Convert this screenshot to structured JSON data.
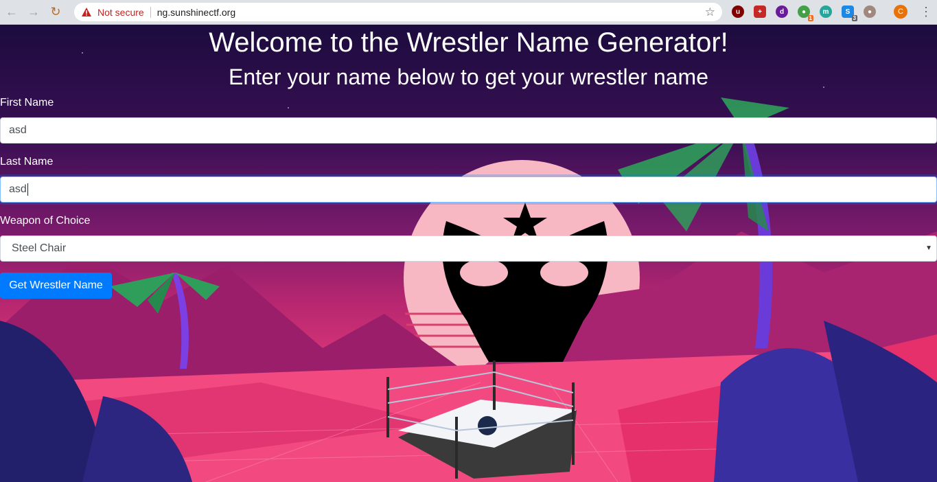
{
  "browser": {
    "security_label": "Not secure",
    "url": "ng.sunshinectf.org",
    "extension_badges": [
      "1",
      "3"
    ],
    "profile_initial": "C"
  },
  "page": {
    "title": "Welcome to the Wrestler Name Generator!",
    "subtitle": "Enter your name below to get your wrestler name",
    "first_name": {
      "label": "First Name",
      "value": "asd"
    },
    "last_name": {
      "label": "Last Name",
      "value": "asd"
    },
    "weapon": {
      "label": "Weapon of Choice",
      "selected": "Steel Chair"
    },
    "submit_label": "Get Wrestler Name"
  },
  "colors": {
    "primary_button": "#007bff",
    "security_warning": "#c5221f"
  }
}
